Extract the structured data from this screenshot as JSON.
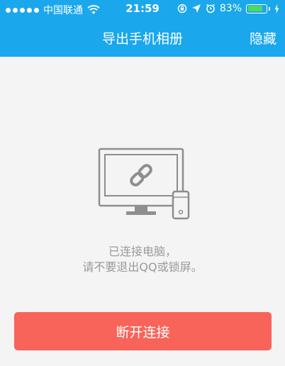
{
  "status_bar": {
    "carrier": "中国联通",
    "time": "21:59",
    "battery_percent": "83%",
    "battery_level": 0.83,
    "battery_color": "#4cd964",
    "icons": [
      "signal-dots-icon",
      "wifi-icon",
      "rotation-lock-icon",
      "location-arrow-icon",
      "alarm-icon",
      "battery-icon",
      "charging-bolt-icon"
    ]
  },
  "nav": {
    "title": "导出手机相册",
    "hide_label": "隐藏",
    "background": "#1aa7ec"
  },
  "illustration": {
    "icons": [
      "monitor-icon",
      "link-icon",
      "phone-icon"
    ]
  },
  "message": {
    "line1": "已连接电脑，",
    "line2": "请不要退出QQ或锁屏。"
  },
  "actions": {
    "disconnect_label": "断开连接",
    "disconnect_color": "#f86459"
  }
}
